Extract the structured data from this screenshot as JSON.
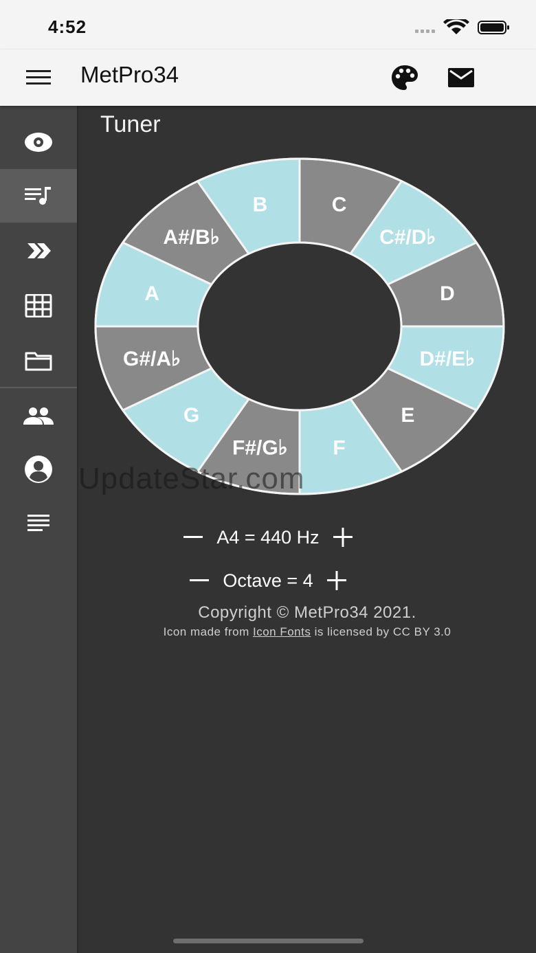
{
  "status": {
    "time": "4:52"
  },
  "app": {
    "title": "MetPro34"
  },
  "page": {
    "title": "Tuner"
  },
  "sidebar": {
    "items": [
      {
        "name": "eye",
        "active": false
      },
      {
        "name": "playlist-music",
        "active": true
      },
      {
        "name": "double-chevron-right",
        "active": false
      },
      {
        "name": "grid",
        "active": false
      },
      {
        "name": "folder",
        "active": false
      },
      {
        "name": "people",
        "active": false
      },
      {
        "name": "account-circle",
        "active": false
      },
      {
        "name": "text-lines",
        "active": false
      }
    ]
  },
  "tuner": {
    "notes": [
      "C",
      "C#/D♭",
      "D",
      "D#/E♭",
      "E",
      "F",
      "F#/G♭",
      "G",
      "G#/A♭",
      "A",
      "A#/B♭",
      "B"
    ],
    "colors": {
      "natural_gray": "#898989",
      "accent_light": "#b0dfe5",
      "border": "#f4f4f4",
      "center": "#333333"
    }
  },
  "controls": {
    "reference": "A4 = 440 Hz",
    "octave": "Octave = 4"
  },
  "footer": {
    "copyright": "Copyright © MetPro34 2021.",
    "license_prefix": "Icon made from",
    "license_link": "Icon Fonts",
    "license_suffix": "is licensed by CC BY 3.0"
  },
  "watermark": "UpdateStar.com"
}
